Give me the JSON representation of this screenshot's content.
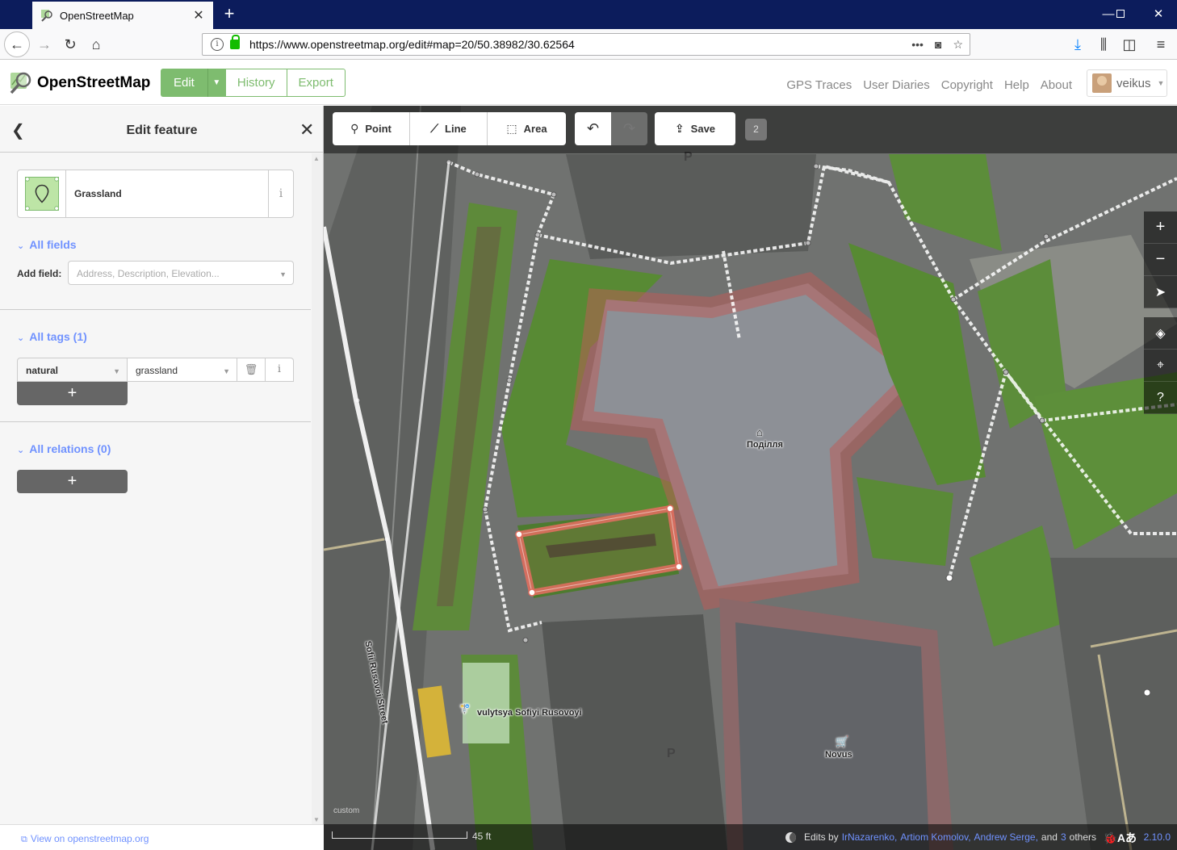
{
  "browser": {
    "tab_title": "OpenStreetMap",
    "url": "https://www.openstreetmap.org/edit#map=20/50.38982/30.62564"
  },
  "header": {
    "site_name": "OpenStreetMap",
    "edit_label": "Edit",
    "history_label": "History",
    "export_label": "Export",
    "links": [
      "GPS Traces",
      "User Diaries",
      "Copyright",
      "Help",
      "About"
    ],
    "username": "veikus"
  },
  "sidebar": {
    "title": "Edit feature",
    "preset_name": "Grassland",
    "all_fields_label": "All fields",
    "add_field_label": "Add field:",
    "add_field_placeholder": "Address, Description, Elevation...",
    "all_tags_label": "All tags (1)",
    "tag_key": "natural",
    "tag_value": "grassland",
    "all_relations_label": "All relations (0)",
    "view_link": "View on openstreetmap.org"
  },
  "toolbar": {
    "point_label": "Point",
    "line_label": "Line",
    "area_label": "Area",
    "save_label": "Save",
    "edit_count": "2"
  },
  "map": {
    "labels": {
      "building": "Поділля",
      "street": "Sofii Rusovoi Street",
      "bus_stop": "vulytsya Sofiyi Rusovoyi",
      "shop": "Novus",
      "parking": "P",
      "imagery": "custom"
    },
    "footer": {
      "scale": "45 ft",
      "edits_by": "Edits by",
      "editors": [
        "IrNazarenko,",
        "Artiom Komolov,",
        "Andrew Serge,"
      ],
      "and_text": "and",
      "others_count": "3",
      "others_text": "others",
      "version": "2.10.0"
    }
  },
  "colors": {
    "osm_green": "#7ebc6f",
    "link_blue": "#7092ff",
    "selected_area": "#e06e5f"
  }
}
